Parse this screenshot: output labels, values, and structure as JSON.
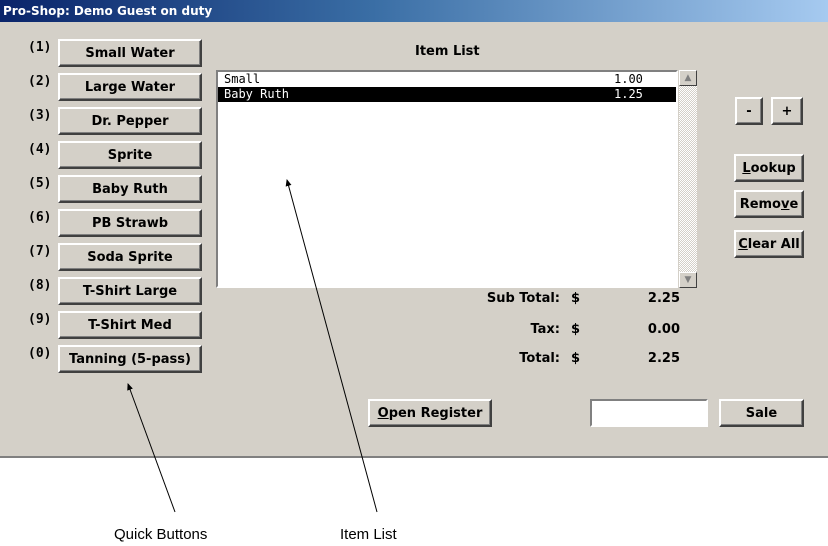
{
  "window": {
    "title": "Pro-Shop: Demo Guest on duty"
  },
  "quick_buttons": [
    {
      "key": "(1)",
      "label": "Small Water"
    },
    {
      "key": "(2)",
      "label": "Large Water"
    },
    {
      "key": "(3)",
      "label": "Dr. Pepper"
    },
    {
      "key": "(4)",
      "label": "Sprite"
    },
    {
      "key": "(5)",
      "label": "Baby Ruth"
    },
    {
      "key": "(6)",
      "label": "PB Strawb"
    },
    {
      "key": "(7)",
      "label": "Soda  Sprite"
    },
    {
      "key": "(8)",
      "label": "T-Shirt  Large"
    },
    {
      "key": "(9)",
      "label": "T-Shirt  Med"
    },
    {
      "key": "(0)",
      "label": "Tanning (5-pass)"
    }
  ],
  "item_list": {
    "heading": "Item List",
    "items": [
      {
        "name": "Small",
        "price": "1.00",
        "selected": false
      },
      {
        "name": "Baby Ruth",
        "price": "1.25",
        "selected": true
      }
    ]
  },
  "right_buttons": {
    "minus": "-",
    "plus": "+",
    "lookup": {
      "mnemonic": "L",
      "rest": "ookup"
    },
    "remove": {
      "pre": "Remo",
      "mnemonic": "v",
      "rest": "e"
    },
    "clear_all": {
      "mnemonic": "C",
      "rest": "lear All"
    }
  },
  "totals": {
    "currency": "$",
    "subtotal_label": "Sub Total:",
    "subtotal": "2.25",
    "tax_label": "Tax:",
    "tax": "0.00",
    "total_label": "Total:",
    "total": "2.25"
  },
  "bottom": {
    "open_register": {
      "mnemonic": "O",
      "rest": "pen Register"
    },
    "amount_value": "",
    "sale": "Sale"
  },
  "annotations": {
    "quick_buttons_caption": "Quick Buttons",
    "item_list_caption": "Item List"
  }
}
